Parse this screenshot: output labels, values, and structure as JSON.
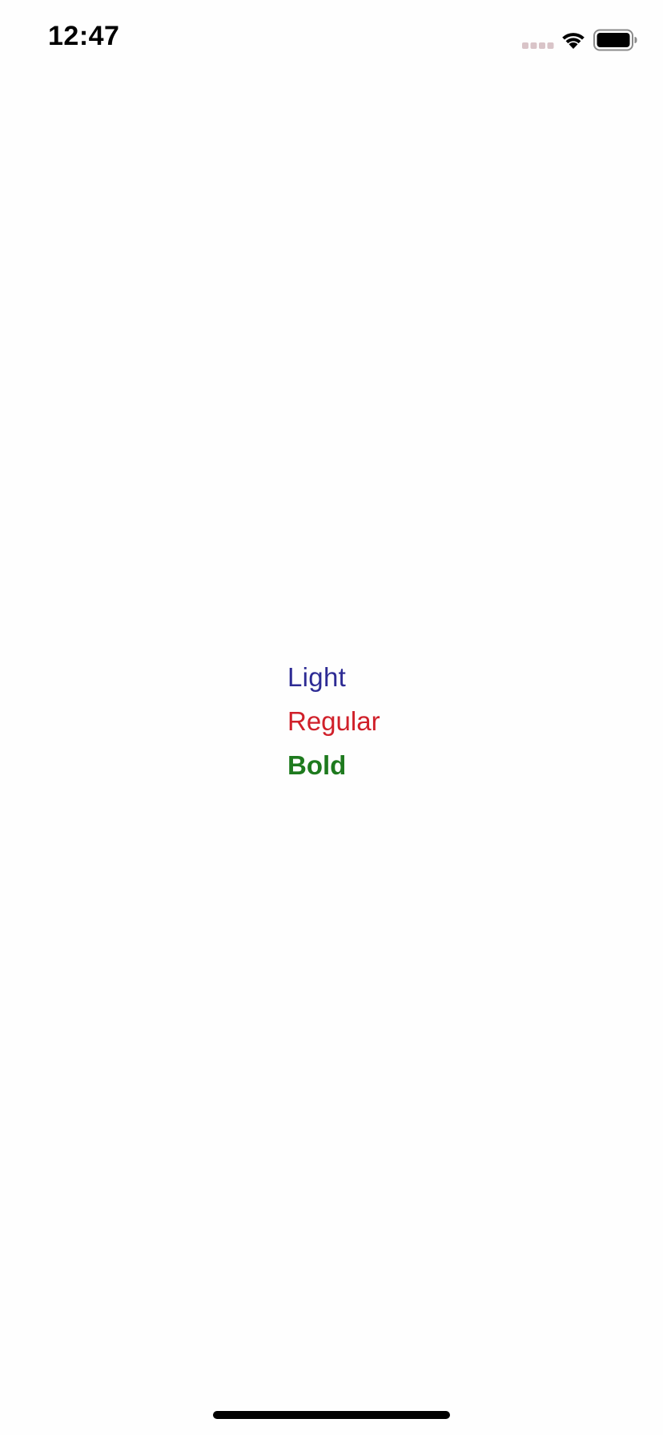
{
  "status_bar": {
    "time": "12:47",
    "signal_icon": "signal-dots-icon",
    "wifi_icon": "wifi-icon",
    "battery_icon": "battery-icon"
  },
  "labels": {
    "light": {
      "text": "Light",
      "color": "#1c1a8c"
    },
    "regular": {
      "text": "Regular",
      "color": "#d0202a"
    },
    "bold": {
      "text": "Bold",
      "color": "#1e7a1e"
    }
  }
}
